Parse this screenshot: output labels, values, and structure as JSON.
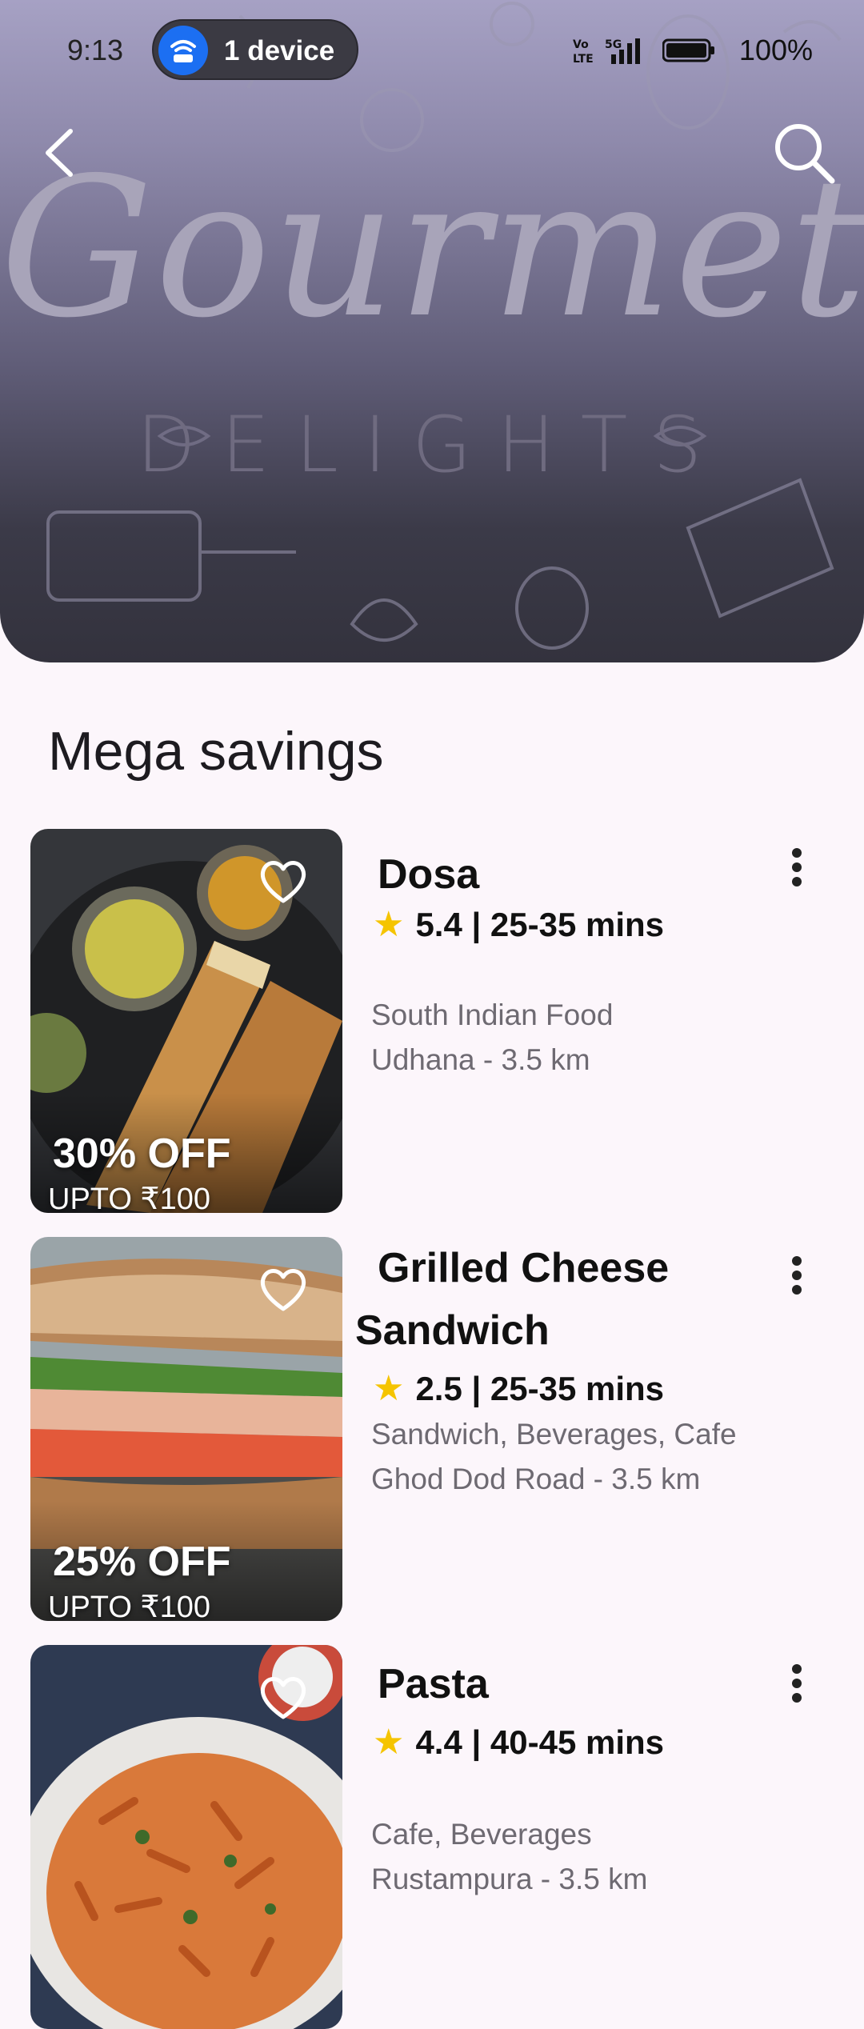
{
  "status": {
    "time": "9:13",
    "device_pill": "1 device",
    "battery": "100%",
    "icons": [
      "hotspot-icon",
      "volte-icon",
      "5g-signal-icon",
      "battery-icon"
    ]
  },
  "header": {
    "title": "Gourmet",
    "subtitle": "DELIGHTS",
    "icons": [
      "back-icon",
      "search-icon"
    ]
  },
  "section": {
    "title": "Mega savings"
  },
  "restaurants": [
    {
      "name": "Dosa",
      "rating": "5.4 | 25-35 mins",
      "cuisine": "South Indian Food",
      "location": "Udhana - 3.5 km",
      "offer": "30% OFF",
      "offer_cap": "UPTO ₹100"
    },
    {
      "name": "Grilled Cheese Sandwich",
      "name_line1": "Grilled Cheese",
      "name_line2": "Sandwich",
      "rating": "2.5 | 25-35 mins",
      "cuisine": "Sandwich, Beverages, Cafe",
      "location": "Ghod Dod Road - 3.5 km",
      "offer": "25% OFF",
      "offer_cap": "UPTO ₹100"
    },
    {
      "name": "Pasta",
      "rating": "4.4 | 40-45 mins",
      "cuisine": "Cafe, Beverages",
      "location": "Rustampura - 3.5 km",
      "offer": "",
      "offer_cap": ""
    }
  ],
  "colors": {
    "background": "#fcf6fb",
    "star": "#f5c400",
    "secondary_text": "#6e6a72"
  }
}
